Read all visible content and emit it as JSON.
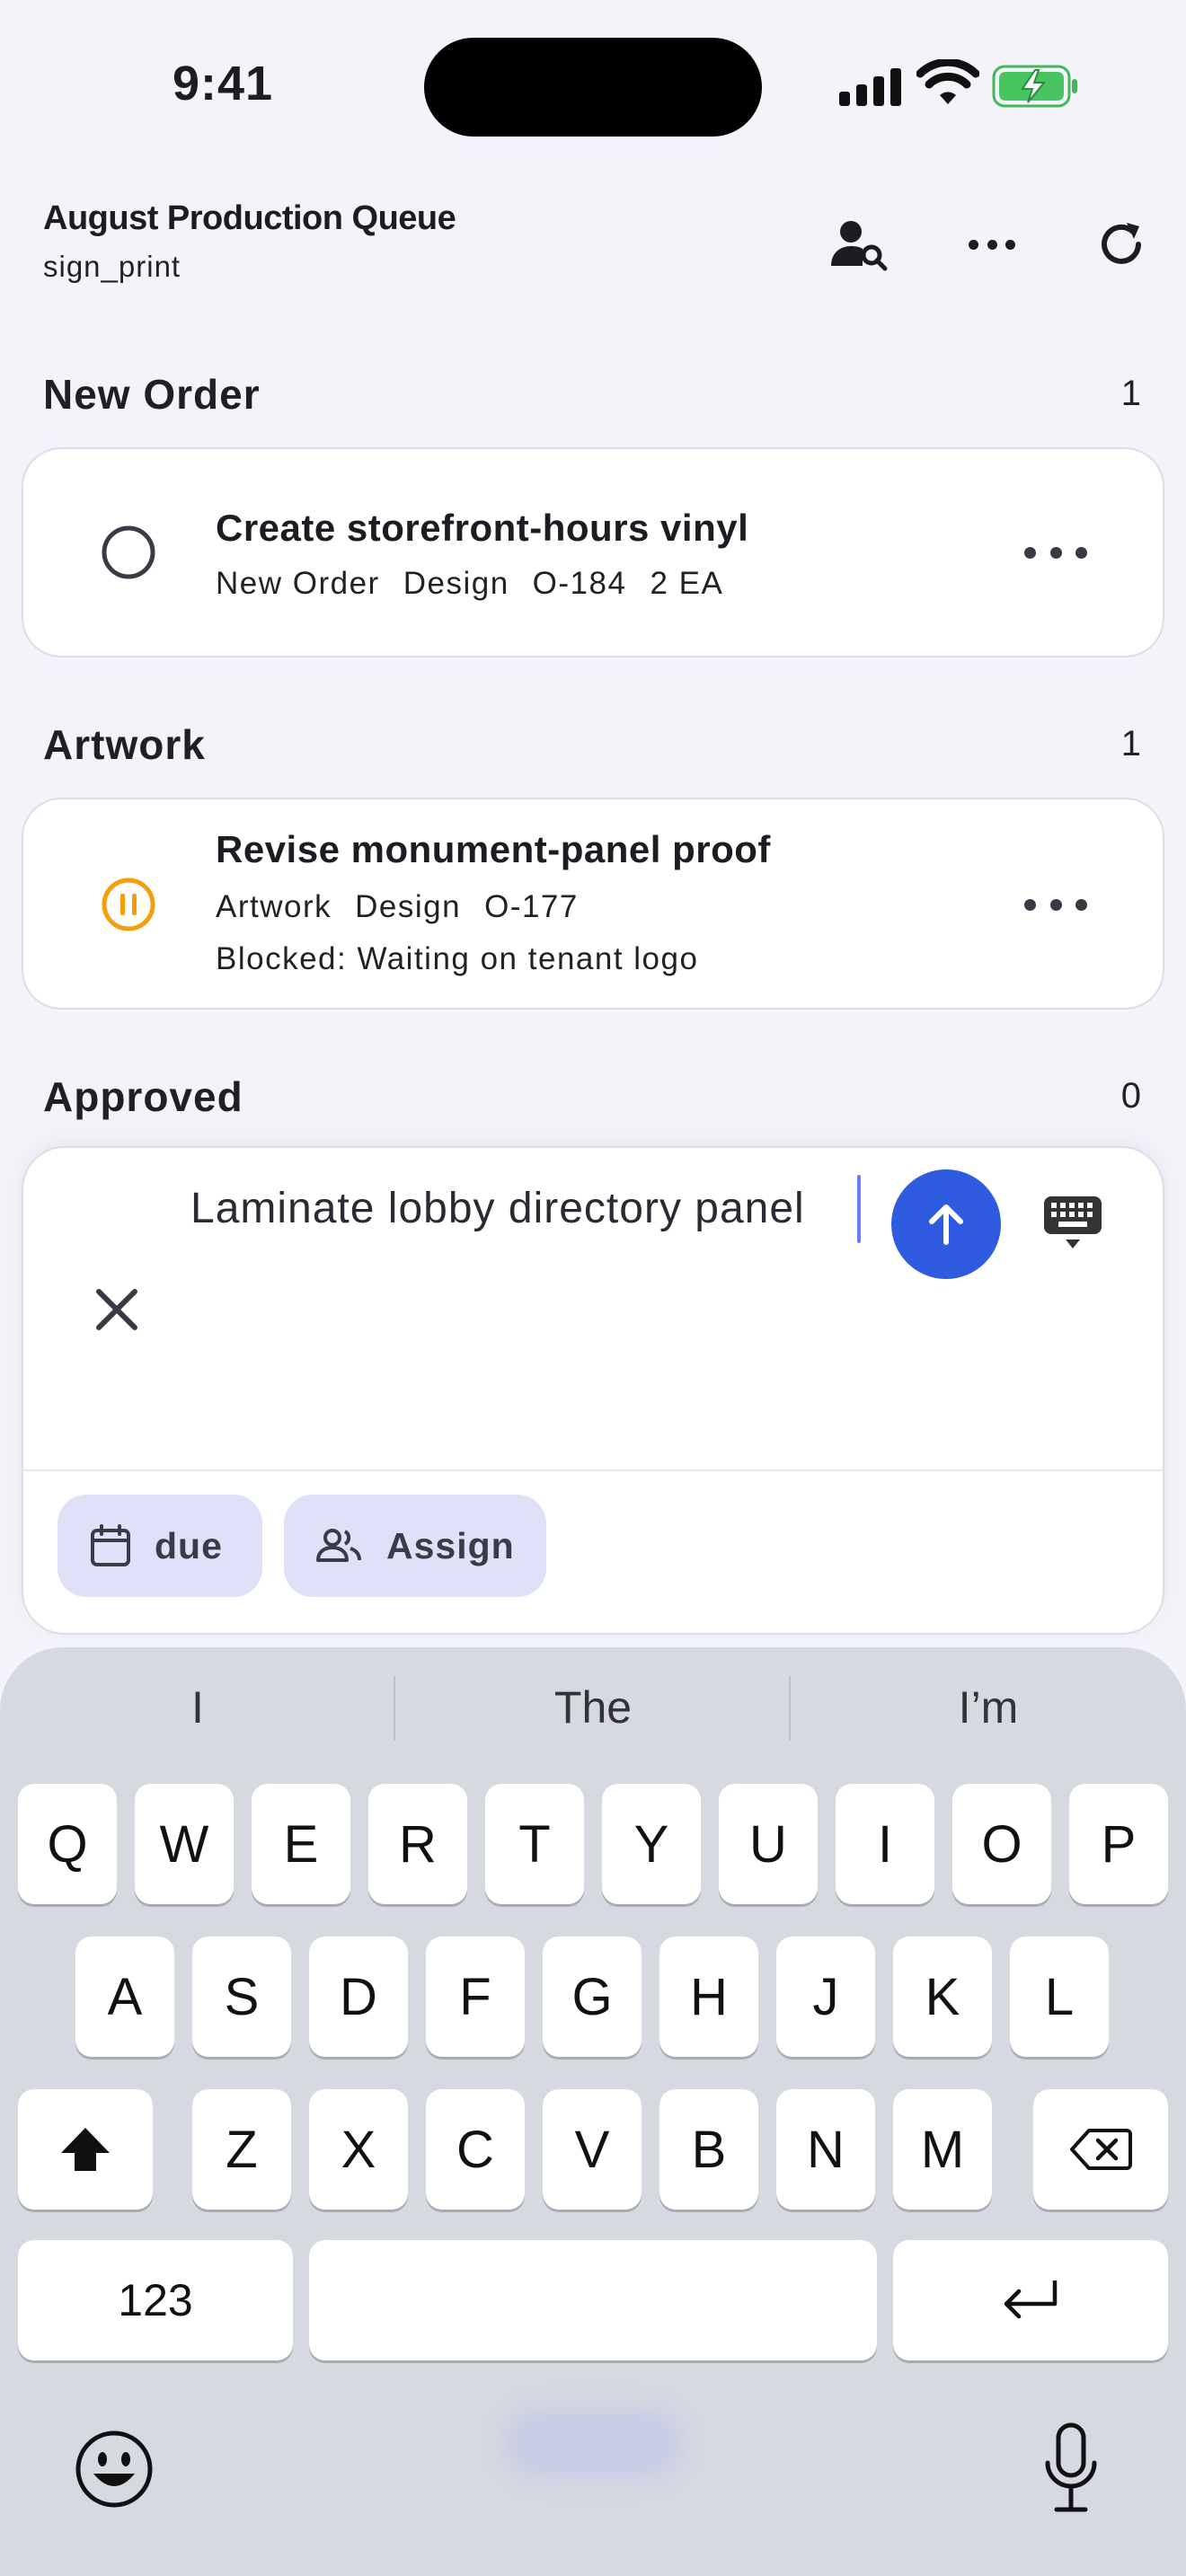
{
  "status_bar": {
    "time": "9:41"
  },
  "header": {
    "title": "August Production Queue",
    "subtitle": "sign_print"
  },
  "sections": [
    {
      "title": "New Order",
      "count": "1",
      "tasks": [
        {
          "title": "Create storefront-hours vinyl",
          "meta": [
            "New Order",
            "Design",
            "O-184",
            "2 EA"
          ],
          "status": "open"
        }
      ]
    },
    {
      "title": "Artwork",
      "count": "1",
      "tasks": [
        {
          "title": "Revise monument-panel proof",
          "meta": [
            "Artwork",
            "Design",
            "O-177"
          ],
          "note": "Blocked: Waiting on tenant logo",
          "status": "paused"
        }
      ]
    },
    {
      "title": "Approved",
      "count": "0",
      "tasks": []
    }
  ],
  "composer": {
    "value": "Laminate lobby directory panel",
    "chips": {
      "due": "due",
      "assign": "Assign"
    }
  },
  "keyboard": {
    "suggestions": [
      "I",
      "The",
      "I’m"
    ],
    "row1": [
      "Q",
      "W",
      "E",
      "R",
      "T",
      "Y",
      "U",
      "I",
      "O",
      "P"
    ],
    "row2": [
      "A",
      "S",
      "D",
      "F",
      "G",
      "H",
      "J",
      "K",
      "L"
    ],
    "row3": [
      "Z",
      "X",
      "C",
      "V",
      "B",
      "N",
      "M"
    ],
    "numbers_label": "123"
  },
  "colors": {
    "accent": "#2f5be0",
    "paused": "#f59e0b",
    "chip_bg": "#dfe1f8"
  },
  "icons": [
    "person-search-icon",
    "more-horizontal-icon",
    "refresh-icon",
    "circle-status-icon",
    "pause-circle-icon",
    "send-arrow-icon",
    "keyboard-dismiss-icon",
    "close-icon",
    "calendar-icon",
    "people-icon",
    "shift-icon",
    "backspace-icon",
    "return-icon",
    "emoji-icon",
    "microphone-icon"
  ]
}
